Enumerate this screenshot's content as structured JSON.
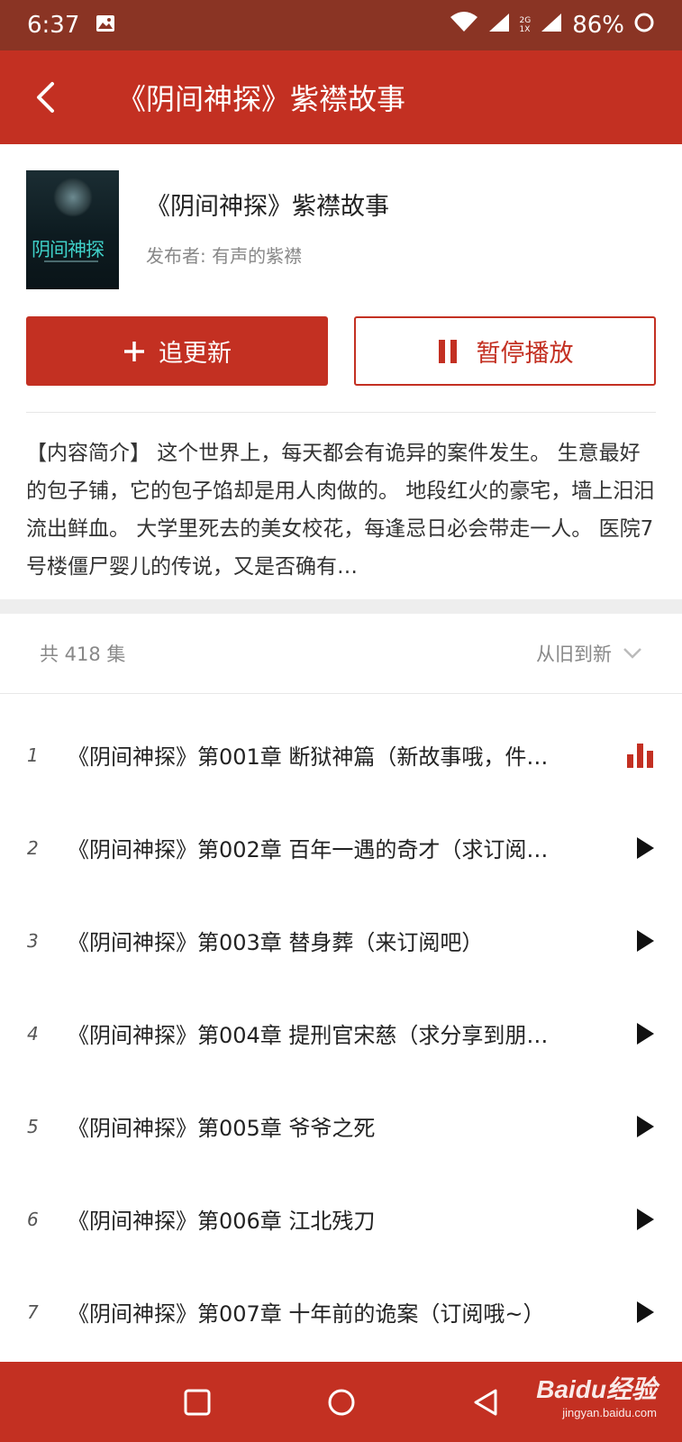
{
  "status_bar": {
    "time": "6:37",
    "battery_percent": "86%",
    "network_top": "2G",
    "network_bottom": "1X"
  },
  "app_bar": {
    "title": "《阴间神探》紫襟故事"
  },
  "book": {
    "title": "《阴间神探》紫襟故事",
    "publisher": "发布者: 有声的紫襟",
    "cover_text": "阴间神探"
  },
  "actions": {
    "follow_label": "追更新",
    "pause_label": "暂停播放"
  },
  "description": "【内容简介】 这个世界上，每天都会有诡异的案件发生。 生意最好的包子铺，它的包子馅却是用人肉做的。 地段红火的豪宅，墙上汨汨流出鲜血。 大学里死去的美女校花，每逢忌日必会带走一人。 医院7号楼僵尸婴儿的传说，又是否确有…",
  "episodes_header": {
    "count": "共 418 集",
    "sort": "从旧到新"
  },
  "episodes": [
    {
      "index": "1",
      "title": "《阴间神探》第001章 断狱神篇（新故事哦，件…",
      "state": "playing"
    },
    {
      "index": "2",
      "title": "《阴间神探》第002章 百年一遇的奇才（求订阅…",
      "state": "idle"
    },
    {
      "index": "3",
      "title": "《阴间神探》第003章 替身葬（来订阅吧）",
      "state": "idle"
    },
    {
      "index": "4",
      "title": "《阴间神探》第004章 提刑官宋慈（求分享到朋…",
      "state": "idle"
    },
    {
      "index": "5",
      "title": "《阴间神探》第005章 爷爷之死",
      "state": "idle"
    },
    {
      "index": "6",
      "title": "《阴间神探》第006章 江北残刀",
      "state": "idle"
    },
    {
      "index": "7",
      "title": "《阴间神探》第007章 十年前的诡案（订阅哦~）",
      "state": "idle"
    }
  ],
  "watermark": {
    "main": "Baidu经验",
    "sub": "jingyan.baidu.com"
  },
  "colors": {
    "accent": "#c33022",
    "status_bar": "#8a3424"
  }
}
